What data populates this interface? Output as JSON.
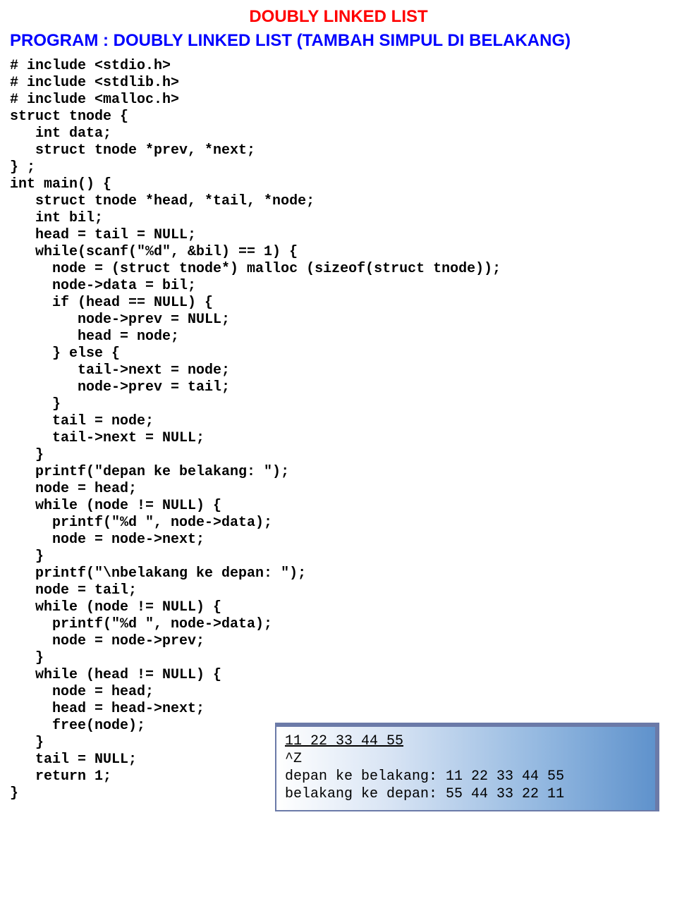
{
  "title": "DOUBLY LINKED LIST",
  "subtitle": "PROGRAM : DOUBLY LINKED LIST (TAMBAH SIMPUL DI BELAKANG)",
  "code": "# include <stdio.h>\n# include <stdlib.h>\n# include <malloc.h>\nstruct tnode {\n   int data;\n   struct tnode *prev, *next;\n} ;\nint main() {\n   struct tnode *head, *tail, *node;\n   int bil;\n   head = tail = NULL;\n   while(scanf(\"%d\", &bil) == 1) {\n     node = (struct tnode*) malloc (sizeof(struct tnode));\n     node->data = bil;\n     if (head == NULL) {\n        node->prev = NULL;\n        head = node;\n     } else {\n        tail->next = node;\n        node->prev = tail;\n     }\n     tail = node;\n     tail->next = NULL;\n   }\n   printf(\"depan ke belakang: \");\n   node = head;\n   while (node != NULL) {\n     printf(\"%d \", node->data);\n     node = node->next;\n   }\n   printf(\"\\nbelakang ke depan: \");\n   node = tail;\n   while (node != NULL) {\n     printf(\"%d \", node->data);\n     node = node->prev;\n   }\n   while (head != NULL) {\n     node = head;\n     head = head->next;\n     free(node);\n   }\n   tail = NULL;\n   return 1;\n}",
  "output": {
    "input_line": "11 22 33 44 55",
    "eof": "^Z",
    "line1": "depan ke belakang: 11 22 33 44 55",
    "line2": "belakang ke depan: 55 44 33 22 11"
  }
}
